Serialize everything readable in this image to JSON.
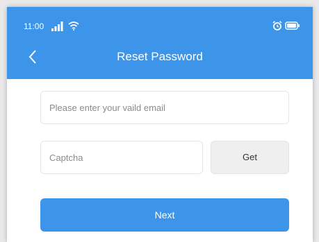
{
  "colors": {
    "primary": "#3d95ea",
    "background": "#ffffff",
    "secondary_button": "#efefef",
    "border": "#e6e6e6"
  },
  "status_bar": {
    "time": "11:00",
    "icons": [
      "signal-icon",
      "wifi-icon",
      "alarm-icon",
      "battery-icon"
    ]
  },
  "header": {
    "title": "Reset Password",
    "back_icon": "chevron-left-icon"
  },
  "form": {
    "email": {
      "value": "",
      "placeholder": "Please enter your vaild email"
    },
    "captcha": {
      "value": "",
      "placeholder": "Captcha"
    },
    "get_label": "Get",
    "next_label": "Next"
  }
}
